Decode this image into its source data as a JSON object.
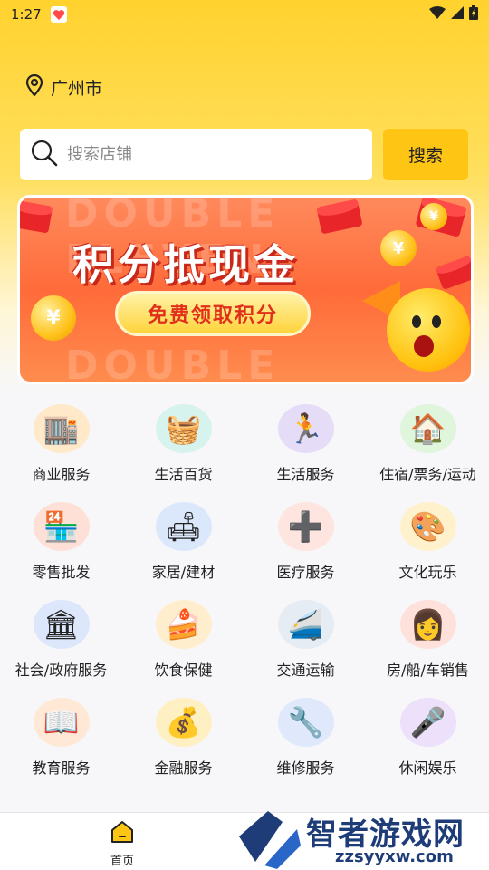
{
  "status_bar": {
    "time": "1:27",
    "notification_icon": "heart-app-icon",
    "icons": [
      "wifi-icon",
      "signal-icon",
      "battery-icon"
    ]
  },
  "location": {
    "icon": "location-pin-icon",
    "city": "广州市"
  },
  "search": {
    "placeholder": "搜索店铺",
    "button_label": "搜索",
    "accent_color": "#ffc515"
  },
  "banner": {
    "title": "积分抵现金",
    "cta": "免费领取积分",
    "deco_text": "DOUBLE ELEVEN"
  },
  "categories": [
    {
      "label": "商业服务",
      "icon": "shop-building-icon",
      "bg": "#ffe9c8"
    },
    {
      "label": "生活百货",
      "icon": "shopping-basket-icon",
      "bg": "#d6f3ee"
    },
    {
      "label": "生活服务",
      "icon": "treadmill-icon",
      "bg": "#e5dcf8"
    },
    {
      "label": "住宿/票务/运动",
      "icon": "house-map-icon",
      "bg": "#dff5dc"
    },
    {
      "label": "零售批发",
      "icon": "storefront-icon",
      "bg": "#ffe0d6"
    },
    {
      "label": "家居/建材",
      "icon": "sofa-icon",
      "bg": "#dbe8fb"
    },
    {
      "label": "医疗服务",
      "icon": "medical-kit-icon",
      "bg": "#ffe5e0"
    },
    {
      "label": "文化玩乐",
      "icon": "paint-palette-icon",
      "bg": "#fff1cc"
    },
    {
      "label": "社会/政府服务",
      "icon": "government-building-icon",
      "bg": "#dce7fb"
    },
    {
      "label": "饮食保健",
      "icon": "cake-icon",
      "bg": "#ffeecd"
    },
    {
      "label": "交通运输",
      "icon": "train-icon",
      "bg": "#e5ecf3"
    },
    {
      "label": "房/船/车销售",
      "icon": "saleswoman-icon",
      "bg": "#ffe1dc"
    },
    {
      "label": "教育服务",
      "icon": "book-icon",
      "bg": "#ffe9d6"
    },
    {
      "label": "金融服务",
      "icon": "coin-cart-icon",
      "bg": "#fff0c4"
    },
    {
      "label": "维修服务",
      "icon": "repairman-icon",
      "bg": "#dfe9fb"
    },
    {
      "label": "休闲娱乐",
      "icon": "microphone-icon",
      "bg": "#ece0fb"
    }
  ],
  "bottom_nav": {
    "home_label": "首页",
    "home_icon": "home-icon"
  },
  "watermark": {
    "name": "智者游戏网",
    "url": "zzsyyxw.com"
  }
}
